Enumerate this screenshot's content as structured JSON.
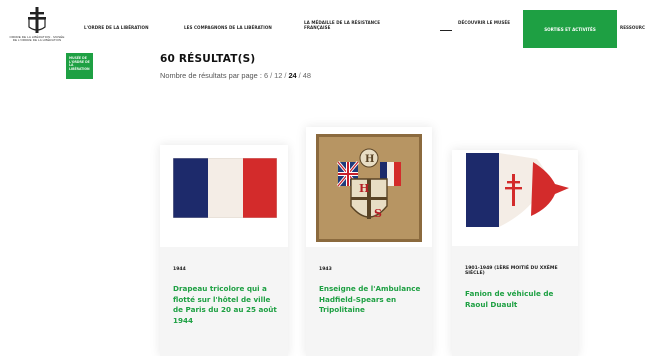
{
  "header": {
    "logo_text": "ORDRE DE LA LIBÉRATION · MUSÉE DE L'ORDRE DE LA LIBÉRATION",
    "nav": [
      {
        "label": "L'ORDRE DE LA LIBÉRATION"
      },
      {
        "label": "LES COMPAGNONS DE LA LIBÉRATION"
      },
      {
        "label": "LA MÉDAILLE DE LA RÉSISTANCE FRANÇAISE"
      },
      {
        "label": "DÉCOUVRIR LE MUSÉE"
      },
      {
        "label": "SORTIES ET ACTIVITÉS"
      },
      {
        "label": "RESSOURC"
      }
    ],
    "accent_color": "#1ea043"
  },
  "brand_box": {
    "label": "MUSÉE DE L'ORDRE DE LA LIBÉRATION"
  },
  "results": {
    "title": "60 RÉSULTAT(S)",
    "per_page_label": "Nombre de résultats par page :",
    "per_page_options": [
      "6",
      "12",
      "24",
      "48"
    ],
    "per_page_selected": "24"
  },
  "cards": [
    {
      "date": "1944",
      "title": "Drapeau tricolore qui a flotté sur l'hôtel de ville de Paris du 20 au 25 août 1944",
      "image_icon": "french-tricolour-flag"
    },
    {
      "date": "1943",
      "title": "Enseigne de l'Ambulance Hadfield-Spears en Tripolitaine",
      "image_icon": "hadfield-spears-ambulance-sign"
    },
    {
      "date": "1901-1949 (1ÈRE MOITIÉ DU XXÈME SIÈCLE)",
      "title": "Fanion de véhicule de Raoul Duault",
      "image_icon": "lorraine-cross-pennant"
    }
  ]
}
